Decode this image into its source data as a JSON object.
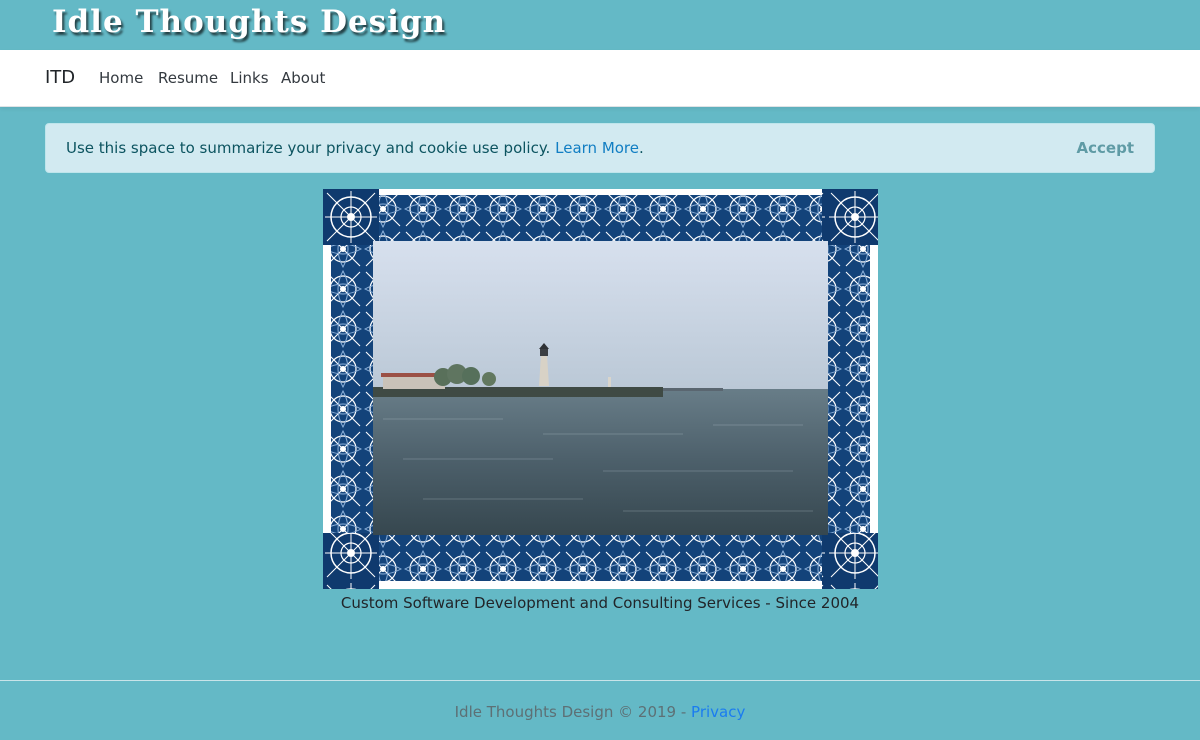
{
  "banner": {
    "title": "Idle Thoughts Design"
  },
  "navbar": {
    "brand": "ITD",
    "links": [
      "Home",
      "Resume",
      "Links",
      "About"
    ]
  },
  "cookie_notice": {
    "text": "Use this space to summarize your privacy and cookie use policy.",
    "learn_more": "Learn More",
    "period": ".",
    "accept": "Accept"
  },
  "main": {
    "image_icon": "celtic-framed-lighthouse-photo",
    "tagline": "Custom Software Development and Consulting Services - Since 2004"
  },
  "footer": {
    "copyright": "Idle Thoughts Design © 2019 -",
    "privacy": "Privacy"
  },
  "colors": {
    "page_bg": "#64b9c6",
    "alert_bg": "#d2eaf1",
    "link": "#117ec3",
    "frame_blue": "#13437a"
  }
}
